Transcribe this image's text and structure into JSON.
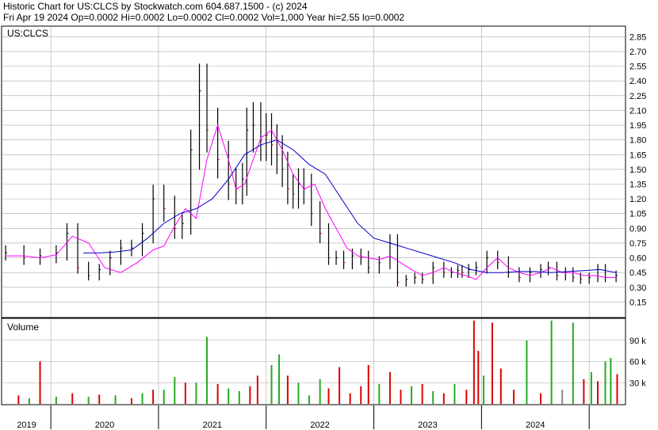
{
  "header": {
    "line1": "Historic Chart for US:CLCS by Stockwatch.com 604.687.1500 - (c) 2024",
    "line2": "Fri Apr 19 2024   Op=0.0002  Hi=0.0002  Lo=0.0002  Cl=0.0002  Vol=1,000   Year hi=2.55  lo=0.0002"
  },
  "colors": {
    "price": "#000000",
    "down_tick": "#cc0000",
    "ma_short": "#ff00ff",
    "ma_long": "#0000cc",
    "volume_up": "#22aa22",
    "volume_down": "#dd0000",
    "volume_flat": "#888888",
    "grid": "#aaaaaa"
  },
  "chart_data": [
    {
      "type": "line",
      "title": "US:CLCS",
      "ylim": [
        0.0,
        2.95
      ],
      "y_ticks": [
        "2.85",
        "2.70",
        "2.55",
        "2.40",
        "2.25",
        "2.10",
        "1.95",
        "1.80",
        "1.65",
        "1.50",
        "1.35",
        "1.20",
        "1.05",
        "0.90",
        "0.75",
        "0.60",
        "0.45",
        "0.30",
        "0.15"
      ],
      "x_ticks": [
        "2019",
        "2020",
        "2021",
        "2022",
        "2023",
        "2024"
      ],
      "grid": true,
      "series": [
        {
          "role": "price",
          "x": [
            2018.58,
            2018.75,
            2018.9,
            2019.05,
            2019.15,
            2019.25,
            2019.35,
            2019.45,
            2019.55,
            2019.65,
            2019.75,
            2019.85,
            2019.95,
            2020.05,
            2020.15,
            2020.22,
            2020.3,
            2020.38,
            2020.45,
            2020.55,
            2020.65,
            2020.72,
            2020.78,
            2020.82,
            2020.88,
            2020.95,
            2021.0,
            2021.05,
            2021.1,
            2021.15,
            2021.2,
            2021.25,
            2021.3,
            2021.35,
            2021.42,
            2021.5,
            2021.58,
            2021.65,
            2021.72,
            2021.8,
            2021.88,
            2021.95,
            2022.05,
            2022.15,
            2022.22,
            2022.3,
            2022.38,
            2022.45,
            2022.55,
            2022.65,
            2022.72,
            2022.78,
            2022.82,
            2022.88,
            2022.95,
            2023.05,
            2023.15,
            2023.25,
            2023.35,
            2023.45,
            2023.55,
            2023.62,
            2023.7,
            2023.78,
            2023.85,
            2023.92,
            2024.0,
            2024.08,
            2024.15,
            2024.25
          ],
          "y": [
            0.65,
            0.6,
            0.62,
            0.65,
            0.85,
            0.5,
            0.42,
            0.48,
            0.6,
            0.7,
            0.7,
            0.85,
            1.2,
            1.1,
            0.9,
            0.95,
            1.7,
            2.3,
            1.9,
            1.6,
            1.35,
            1.3,
            1.4,
            1.9,
            1.95,
            1.8,
            1.85,
            1.75,
            1.65,
            1.5,
            1.3,
            1.25,
            1.35,
            1.3,
            1.05,
            0.85,
            0.6,
            0.6,
            0.55,
            0.62,
            0.6,
            0.5,
            0.55,
            0.75,
            0.35,
            0.38,
            0.4,
            0.38,
            0.5,
            0.45,
            0.45,
            0.47,
            0.45,
            0.48,
            0.5,
            0.6,
            0.55,
            0.45,
            0.4,
            0.45,
            0.48,
            0.5,
            0.42,
            0.45,
            0.4,
            0.38,
            0.4,
            0.48,
            0.4,
            0.42
          ]
        },
        {
          "name": "",
          "role": "ma_short",
          "x": [
            2018.58,
            2018.75,
            2018.9,
            2019.05,
            2019.2,
            2019.35,
            2019.5,
            2019.65,
            2019.8,
            2019.95,
            2020.05,
            2020.15,
            2020.25,
            2020.35,
            2020.45,
            2020.55,
            2020.65,
            2020.72,
            2020.8,
            2020.88,
            2020.95,
            2021.05,
            2021.15,
            2021.25,
            2021.35,
            2021.45,
            2021.55,
            2021.65,
            2021.75,
            2021.85,
            2021.95,
            2022.05,
            2022.15,
            2022.25,
            2022.35,
            2022.45,
            2022.55,
            2022.65,
            2022.75,
            2022.85,
            2022.95,
            2023.05,
            2023.15,
            2023.25,
            2023.35,
            2023.45,
            2023.55,
            2023.65,
            2023.75,
            2023.85,
            2023.95,
            2024.05,
            2024.15,
            2024.25
          ],
          "y": [
            0.62,
            0.62,
            0.6,
            0.63,
            0.82,
            0.75,
            0.5,
            0.45,
            0.55,
            0.68,
            0.72,
            0.92,
            1.1,
            1.0,
            1.6,
            1.95,
            1.6,
            1.3,
            1.35,
            1.6,
            1.82,
            1.9,
            1.7,
            1.45,
            1.3,
            1.35,
            1.1,
            0.9,
            0.7,
            0.62,
            0.6,
            0.58,
            0.62,
            0.55,
            0.48,
            0.42,
            0.45,
            0.5,
            0.45,
            0.42,
            0.38,
            0.5,
            0.6,
            0.5,
            0.45,
            0.42,
            0.45,
            0.5,
            0.45,
            0.45,
            0.42,
            0.42,
            0.4,
            0.4
          ]
        },
        {
          "name": "",
          "role": "ma_long",
          "x": [
            2019.3,
            2019.45,
            2019.6,
            2019.75,
            2019.9,
            2020.05,
            2020.2,
            2020.35,
            2020.5,
            2020.65,
            2020.8,
            2020.95,
            2021.1,
            2021.25,
            2021.4,
            2021.55,
            2021.7,
            2021.85,
            2022.0,
            2022.15,
            2022.3,
            2022.45,
            2022.6,
            2022.75,
            2022.9,
            2023.05,
            2023.2,
            2023.35,
            2023.5,
            2023.65,
            2023.8,
            2023.95,
            2024.1,
            2024.25
          ],
          "y": [
            0.65,
            0.65,
            0.66,
            0.68,
            0.8,
            0.95,
            1.05,
            1.1,
            1.2,
            1.4,
            1.65,
            1.75,
            1.8,
            1.7,
            1.55,
            1.45,
            1.2,
            0.95,
            0.8,
            0.75,
            0.7,
            0.65,
            0.6,
            0.55,
            0.48,
            0.45,
            0.45,
            0.46,
            0.46,
            0.45,
            0.46,
            0.47,
            0.48,
            0.45
          ]
        }
      ]
    },
    {
      "type": "bar",
      "title": "Volume",
      "ylim": [
        0,
        120000
      ],
      "y_ticks": [
        "90 k",
        "60 k",
        "30 k"
      ],
      "x_ticks": [
        "2019",
        "2020",
        "2021",
        "2022",
        "2023",
        "2024"
      ],
      "grid": true,
      "bars": [
        {
          "x": 2018.7,
          "v": 12000,
          "c": "down"
        },
        {
          "x": 2018.8,
          "v": 8000,
          "c": "up"
        },
        {
          "x": 2018.9,
          "v": 60000,
          "c": "down"
        },
        {
          "x": 2019.05,
          "v": 10000,
          "c": "up"
        },
        {
          "x": 2019.2,
          "v": 15000,
          "c": "down"
        },
        {
          "x": 2019.35,
          "v": 10000,
          "c": "up"
        },
        {
          "x": 2019.45,
          "v": 13000,
          "c": "down"
        },
        {
          "x": 2019.6,
          "v": 12000,
          "c": "up"
        },
        {
          "x": 2019.75,
          "v": 8000,
          "c": "down"
        },
        {
          "x": 2019.85,
          "v": 15000,
          "c": "up"
        },
        {
          "x": 2019.95,
          "v": 20000,
          "c": "down"
        },
        {
          "x": 2020.05,
          "v": 20000,
          "c": "up"
        },
        {
          "x": 2020.15,
          "v": 38000,
          "c": "up"
        },
        {
          "x": 2020.25,
          "v": 30000,
          "c": "down"
        },
        {
          "x": 2020.35,
          "v": 30000,
          "c": "up"
        },
        {
          "x": 2020.45,
          "v": 95000,
          "c": "up"
        },
        {
          "x": 2020.55,
          "v": 28000,
          "c": "down"
        },
        {
          "x": 2020.65,
          "v": 22000,
          "c": "up"
        },
        {
          "x": 2020.75,
          "v": 18000,
          "c": "up"
        },
        {
          "x": 2020.85,
          "v": 25000,
          "c": "down"
        },
        {
          "x": 2020.92,
          "v": 40000,
          "c": "down"
        },
        {
          "x": 2021.05,
          "v": 55000,
          "c": "up"
        },
        {
          "x": 2021.12,
          "v": 70000,
          "c": "up"
        },
        {
          "x": 2021.2,
          "v": 40000,
          "c": "down"
        },
        {
          "x": 2021.3,
          "v": 30000,
          "c": "up"
        },
        {
          "x": 2021.4,
          "v": 12000,
          "c": "up"
        },
        {
          "x": 2021.5,
          "v": 35000,
          "c": "up"
        },
        {
          "x": 2021.58,
          "v": 22000,
          "c": "down"
        },
        {
          "x": 2021.68,
          "v": 52000,
          "c": "down"
        },
        {
          "x": 2021.78,
          "v": 15000,
          "c": "down"
        },
        {
          "x": 2021.88,
          "v": 25000,
          "c": "down"
        },
        {
          "x": 2021.95,
          "v": 55000,
          "c": "down"
        },
        {
          "x": 2022.05,
          "v": 28000,
          "c": "up"
        },
        {
          "x": 2022.15,
          "v": 45000,
          "c": "down"
        },
        {
          "x": 2022.25,
          "v": 20000,
          "c": "down"
        },
        {
          "x": 2022.35,
          "v": 25000,
          "c": "up"
        },
        {
          "x": 2022.45,
          "v": 28000,
          "c": "down"
        },
        {
          "x": 2022.55,
          "v": 18000,
          "c": "up"
        },
        {
          "x": 2022.65,
          "v": 15000,
          "c": "down"
        },
        {
          "x": 2022.75,
          "v": 28000,
          "c": "up"
        },
        {
          "x": 2022.86,
          "v": 20000,
          "c": "down"
        },
        {
          "x": 2022.93,
          "v": 118000,
          "c": "down"
        },
        {
          "x": 2022.97,
          "v": 75000,
          "c": "down"
        },
        {
          "x": 2023.02,
          "v": 40000,
          "c": "up"
        },
        {
          "x": 2023.1,
          "v": 115000,
          "c": "down"
        },
        {
          "x": 2023.18,
          "v": 50000,
          "c": "down"
        },
        {
          "x": 2023.3,
          "v": 20000,
          "c": "down"
        },
        {
          "x": 2023.42,
          "v": 90000,
          "c": "up"
        },
        {
          "x": 2023.55,
          "v": 15000,
          "c": "down"
        },
        {
          "x": 2023.65,
          "v": 118000,
          "c": "up"
        },
        {
          "x": 2023.75,
          "v": 20000,
          "c": "flat"
        },
        {
          "x": 2023.85,
          "v": 115000,
          "c": "up"
        },
        {
          "x": 2023.95,
          "v": 35000,
          "c": "down"
        },
        {
          "x": 2024.02,
          "v": 45000,
          "c": "up"
        },
        {
          "x": 2024.08,
          "v": 32000,
          "c": "down"
        },
        {
          "x": 2024.15,
          "v": 60000,
          "c": "up"
        },
        {
          "x": 2024.2,
          "v": 65000,
          "c": "up"
        },
        {
          "x": 2024.26,
          "v": 42000,
          "c": "down"
        }
      ]
    }
  ]
}
